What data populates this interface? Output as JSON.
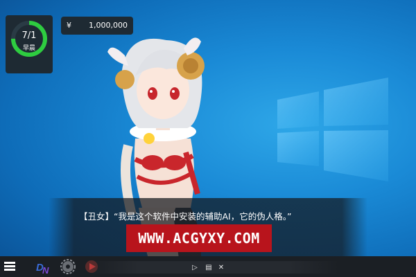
{
  "hud": {
    "date": "7/1",
    "time_of_day": "早晨",
    "day_progress": 0.75,
    "ring_color": "#2ecc40",
    "currency_symbol": "¥",
    "money": "1,000,000"
  },
  "dialogue": {
    "text": "【丑女】“我是这个软件中安装的辅助AI，它的伪人格。”"
  },
  "watermark": "WWW.ACGYXY.COM",
  "taskbar": {
    "apps": [
      "start-menu-icon",
      "dn-app-icon",
      "gear-app-icon",
      "media-player-icon"
    ]
  },
  "controls": {
    "play_icon": "▷",
    "log_icon": "▤",
    "close_icon": "✕"
  },
  "colors": {
    "desktop_blue": "#1a8ad6",
    "hud_bg": "#1e2a33",
    "watermark_red": "#b8141c"
  }
}
